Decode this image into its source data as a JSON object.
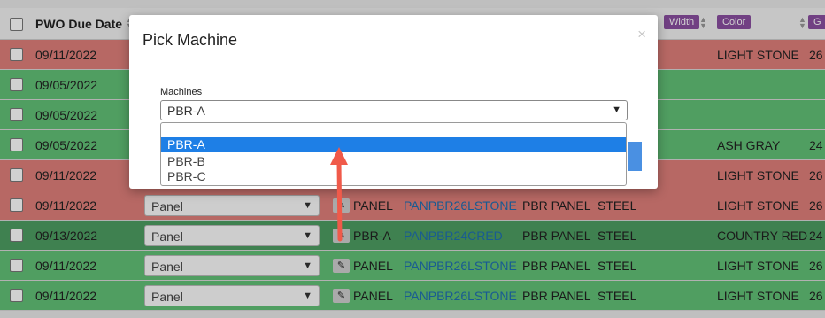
{
  "header": {
    "pwo_due_date": "PWO Due Date",
    "width": "Width",
    "color": "Color",
    "g_tag": "G"
  },
  "rows": [
    {
      "color": "red",
      "date": "09/11/2022",
      "color_name": "LIGHT STONE",
      "gauge": "26"
    },
    {
      "color": "green",
      "date": "09/05/2022",
      "color_name": "",
      "gauge": ""
    },
    {
      "color": "green",
      "date": "09/05/2022",
      "color_name": "",
      "gauge": ""
    },
    {
      "color": "green",
      "date": "09/05/2022",
      "color_name": "ASH GRAY",
      "gauge": "24"
    },
    {
      "color": "red",
      "date": "09/11/2022",
      "color_name": "LIGHT STONE",
      "gauge": "26"
    },
    {
      "color": "red",
      "date": "09/11/2022",
      "type": "Panel",
      "machine": "PANEL",
      "part": "PANPBR26LSTONE",
      "product": "PBR PANEL",
      "material": "STEEL",
      "color_name": "LIGHT STONE",
      "gauge": "26"
    },
    {
      "color": "dkgreen",
      "date": "09/13/2022",
      "type": "Panel",
      "machine": "PBR-A",
      "part": "PANPBR24CRED",
      "product": "PBR PANEL",
      "material": "STEEL",
      "color_name": "COUNTRY RED",
      "gauge": "24"
    },
    {
      "color": "green",
      "date": "09/11/2022",
      "type": "Panel",
      "machine": "PANEL",
      "part": "PANPBR26LSTONE",
      "product": "PBR PANEL",
      "material": "STEEL",
      "color_name": "LIGHT STONE",
      "gauge": "26"
    },
    {
      "color": "green",
      "date": "09/11/2022",
      "type": "Panel",
      "machine": "PANEL",
      "part": "PANPBR26LSTONE",
      "product": "PBR PANEL",
      "material": "STEEL",
      "color_name": "LIGHT STONE",
      "gauge": "26"
    }
  ],
  "modal": {
    "title": "Pick Machine",
    "close": "×",
    "field_label": "Machines",
    "selected": "PBR-A",
    "options": [
      "PBR-A",
      "PBR-B",
      "PBR-C"
    ]
  },
  "icons": {
    "close": "close-icon",
    "edit": "edit-icon",
    "caret": "chevron-down-icon",
    "arrow": "red-arrow-annotation"
  },
  "colors": {
    "row_red": "#e07f7b",
    "row_green": "#62c177",
    "row_dark_green": "#4e9e62",
    "tag_purple": "#8a4fa0",
    "link_blue": "#1f6fb2",
    "option_selected": "#1e7fe6",
    "arrow": "#f05a4a"
  }
}
